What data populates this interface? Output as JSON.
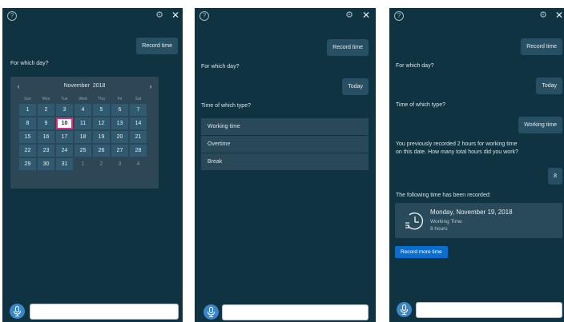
{
  "panel1": {
    "user_message": "Record time",
    "bot_question": "For which day?",
    "calendar": {
      "month": "November",
      "year": "2018",
      "weekdays": [
        "Sun",
        "Mon",
        "Tue",
        "Wed",
        "Thu",
        "Fri",
        "Sat"
      ],
      "days": [
        [
          "1",
          "2",
          "3",
          "4",
          "5",
          "6",
          "7"
        ],
        [
          "8",
          "9",
          "10",
          "11",
          "12",
          "13",
          "14"
        ],
        [
          "15",
          "16",
          "17",
          "18",
          "19",
          "20",
          "21"
        ],
        [
          "22",
          "23",
          "24",
          "25",
          "26",
          "27",
          "28"
        ],
        [
          "29",
          "30",
          "31",
          "1",
          "2",
          "3",
          "4"
        ]
      ],
      "selected_day": "10"
    }
  },
  "panel2": {
    "user_message_1": "Record time",
    "bot_question_1": "For which day?",
    "user_message_2": "Today",
    "bot_question_2": "Time of which type?",
    "options": [
      "Working time",
      "Overtime",
      "Break"
    ]
  },
  "panel3": {
    "user_message_1": "Record time",
    "bot_question_1": "For which day?",
    "user_message_2": "Today",
    "bot_question_2": "Time of which type?",
    "user_message_3": "Working time",
    "bot_message_3_line1": "You previously recorded 2 hours for working time",
    "bot_message_3_line2": "on this date. How many total hours did you work?",
    "user_message_4": "8",
    "bot_message_4": "The following time has been recorded:",
    "result": {
      "date": "Monday, November 19, 2018",
      "type": "Working Time",
      "hours": "8 hours"
    },
    "record_more_button": "Record more time"
  },
  "icons": {
    "help": "?",
    "settings": "⚙",
    "close": "✕",
    "prev": "‹",
    "next": "›"
  },
  "colors": {
    "panel_bg": "#0f3340",
    "user_bubble": "#285064",
    "selected_border": "#d4317a",
    "primary_button": "#0a6ed1",
    "mic_button": "#3a86c8"
  }
}
